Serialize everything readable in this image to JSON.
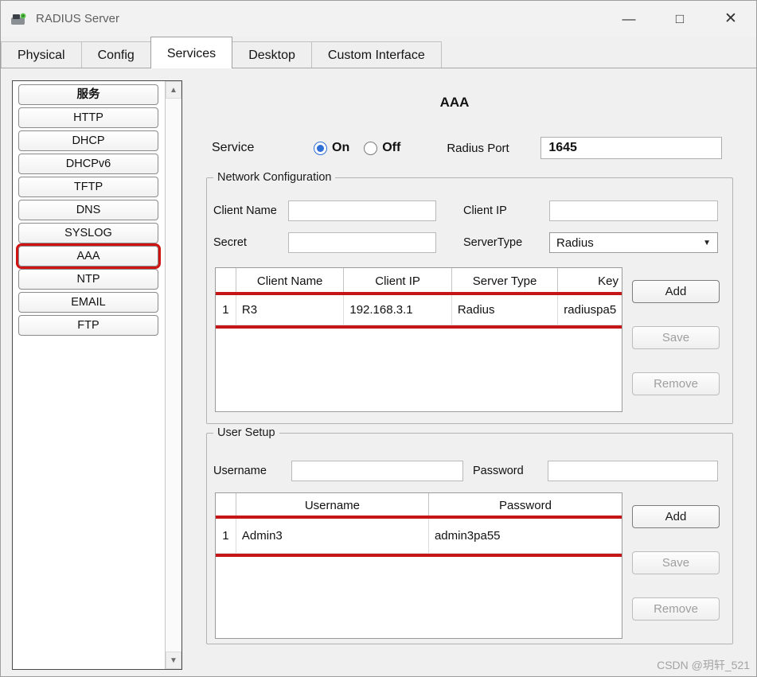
{
  "window": {
    "title": "RADIUS Server",
    "controls": {
      "minimize": "—",
      "maximize": "□",
      "close": "✕"
    }
  },
  "icons": {
    "combo_arrow": "▼",
    "scroll_up": "▲",
    "scroll_down": "▼"
  },
  "tabs": [
    {
      "label": "Physical",
      "active": false
    },
    {
      "label": "Config",
      "active": false
    },
    {
      "label": "Services",
      "active": true
    },
    {
      "label": "Desktop",
      "active": false
    },
    {
      "label": "Custom Interface",
      "active": false
    }
  ],
  "sidebar": {
    "items": [
      {
        "label": "服务",
        "highlighted": false
      },
      {
        "label": "HTTP",
        "highlighted": false
      },
      {
        "label": "DHCP",
        "highlighted": false
      },
      {
        "label": "DHCPv6",
        "highlighted": false
      },
      {
        "label": "TFTP",
        "highlighted": false
      },
      {
        "label": "DNS",
        "highlighted": false
      },
      {
        "label": "SYSLOG",
        "highlighted": false
      },
      {
        "label": "AAA",
        "highlighted": true
      },
      {
        "label": "NTP",
        "highlighted": false
      },
      {
        "label": "EMAIL",
        "highlighted": false
      },
      {
        "label": "FTP",
        "highlighted": false
      }
    ]
  },
  "main": {
    "title": "AAA",
    "service": {
      "label": "Service",
      "on_label": "On",
      "off_label": "Off",
      "on_selected": true,
      "radius_port_label": "Radius Port",
      "radius_port_value": "1645"
    },
    "network_config": {
      "title": "Network Configuration",
      "client_name_label": "Client Name",
      "client_name_value": "",
      "client_ip_label": "Client IP",
      "client_ip_value": "",
      "secret_label": "Secret",
      "secret_value": "",
      "server_type_label": "ServerType",
      "server_type_value": "Radius",
      "table": {
        "headers": [
          "Client Name",
          "Client IP",
          "Server Type",
          "Key"
        ],
        "rows": [
          {
            "num": "1",
            "cells": [
              "R3",
              "192.168.3.1",
              "Radius",
              "radiuspa5"
            ]
          }
        ]
      },
      "buttons": {
        "add": "Add",
        "save": "Save",
        "remove": "Remove"
      }
    },
    "user_setup": {
      "title": "User Setup",
      "username_label": "Username",
      "username_value": "",
      "password_label": "Password",
      "password_value": "",
      "table": {
        "headers": [
          "Username",
          "Password"
        ],
        "rows": [
          {
            "num": "1",
            "cells": [
              "Admin3",
              "admin3pa55"
            ]
          }
        ]
      },
      "buttons": {
        "add": "Add",
        "save": "Save",
        "remove": "Remove"
      }
    }
  },
  "watermark": "CSDN @玥轩_521"
}
